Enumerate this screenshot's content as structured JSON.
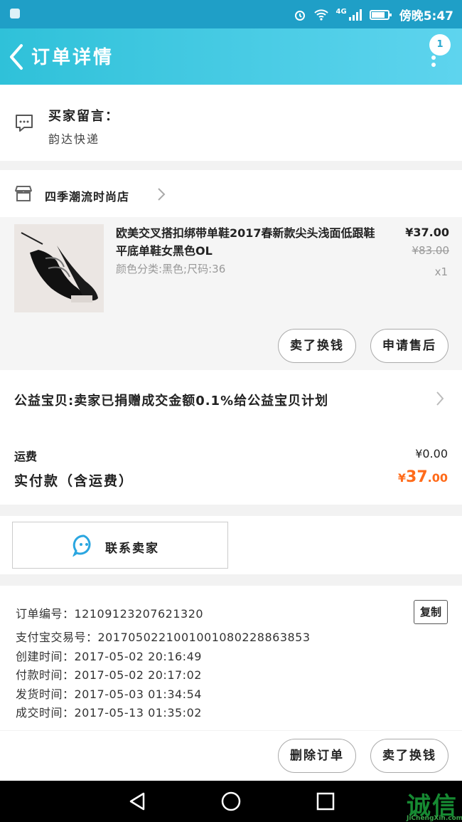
{
  "status_bar": {
    "time": "傍晚5:47",
    "network": "4G"
  },
  "header": {
    "title": "订单详情",
    "badge": "1"
  },
  "buyer_message": {
    "label": "买家留言：",
    "value": "韵达快递"
  },
  "shop": {
    "name": "四季潮流时尚店"
  },
  "item": {
    "title": "欧美交叉搭扣绑带单鞋2017春新款尖头浅面低跟鞋平底单鞋女黑色OL",
    "sku": "颜色分类:黑色;尺码:36",
    "price": "¥37.00",
    "original_price": "¥83.00",
    "quantity": "x1",
    "actions": [
      "卖了换钱",
      "申请售后"
    ]
  },
  "charity": {
    "text": "公益宝贝:卖家已捐赠成交金额0.1%给公益宝贝计划"
  },
  "summary": {
    "shipping_label": "运费",
    "shipping_value": "¥0.00",
    "paid_label": "实付款（含运费）",
    "paid_currency": "¥",
    "paid_integer": "37",
    "paid_decimal": ".00"
  },
  "contact": {
    "label": "联系卖家"
  },
  "order_info": {
    "order_no": "订单编号：1210912320762132​0",
    "alipay_no": "支付宝交易号：2017050221001001080228863853",
    "created": "创建时间：2017-05-02 20:16:49",
    "paid": "付款时间：2017-05-02 20:17:02",
    "shipped": "发货时间：2017-05-03 01:34:54",
    "completed": "成交时间：2017-05-13 01:35:02",
    "copy_label": "复制"
  },
  "bottom_actions": [
    "删除订单",
    "卖了换钱"
  ],
  "watermark": {
    "text": "诚信",
    "sub": "JiChengXin.com"
  },
  "colors": {
    "header_start": "#2fc1d9",
    "header_end": "#5ed4ee",
    "accent_price": "#ff6b1a"
  }
}
